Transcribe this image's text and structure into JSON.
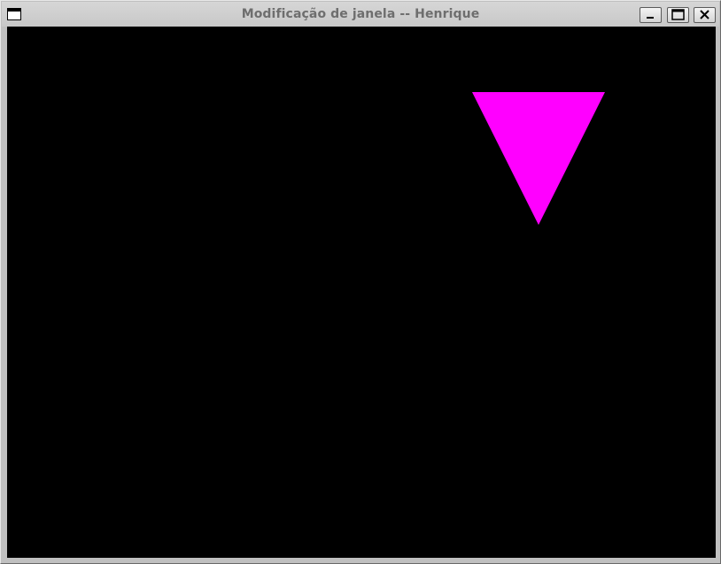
{
  "window": {
    "title": "Modificação de janela -- Henrique"
  },
  "icons": {
    "menu": "window-menu-icon",
    "minimize": "minimize-icon",
    "maximize": "maximize-icon",
    "close": "close-icon"
  },
  "canvas": {
    "background_color": "#000000",
    "shape": {
      "type": "triangle",
      "orientation": "pointing-down",
      "fill_color": "#ff00ff"
    }
  }
}
